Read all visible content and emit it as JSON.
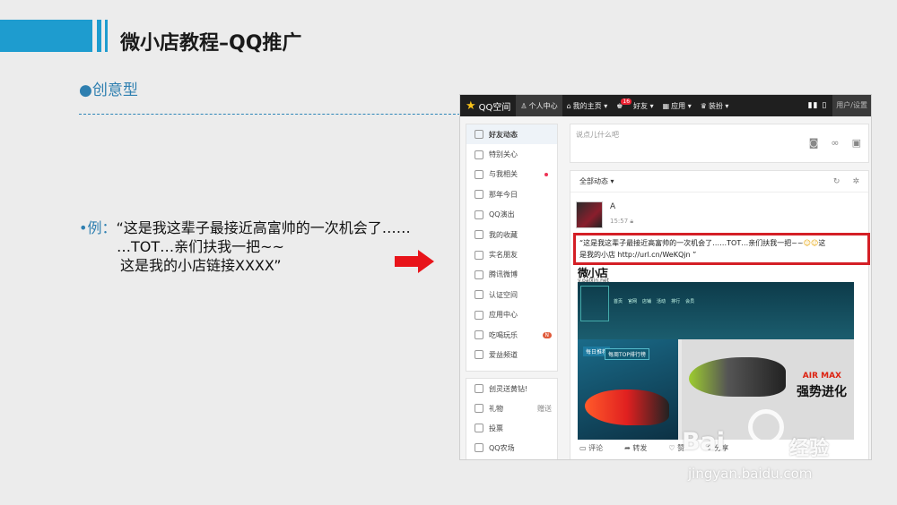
{
  "slide": {
    "title": "微小店教程–QQ推广",
    "subtitle": "●创意型",
    "example_label": "•例：",
    "example_line1": "“这是我这辈子最接近高富帅的一次机会了……",
    "example_line2": "…TOT…亲们扶我一把~~",
    "example_line3": "这是我的小店链接XXXX”"
  },
  "qzone": {
    "logo": "QQ空间",
    "nav": [
      {
        "label": "个人中心"
      },
      {
        "label": "我的主页 ▾"
      },
      {
        "label": "好友 ▾",
        "badge": "16"
      },
      {
        "label": "应用 ▾"
      },
      {
        "label": "装扮 ▾"
      }
    ],
    "user_panel": "用户/设置",
    "sidebar": [
      {
        "label": "好友动态"
      },
      {
        "label": "特别关心"
      },
      {
        "label": "与我相关"
      },
      {
        "label": "那年今日"
      },
      {
        "label": "QQ演出"
      },
      {
        "label": "我的收藏"
      },
      {
        "label": "实名朋友"
      },
      {
        "label": "腾讯微博"
      },
      {
        "label": "认证空间"
      },
      {
        "label": "应用中心"
      },
      {
        "label": "吃喝玩乐",
        "badge": "N"
      },
      {
        "label": "爱益频道"
      }
    ],
    "sidebar2": [
      {
        "label": "创灵送黄钻!"
      },
      {
        "label": "礼物",
        "extra": "赠送"
      },
      {
        "label": "投票"
      },
      {
        "label": "QQ农场"
      }
    ],
    "compose_placeholder": "说点儿什么吧",
    "feed_filter": "全部动态 ▾",
    "post": {
      "author": "A",
      "time": "15:57",
      "text_line1": "“这是我这辈子最接近高富帅的一次机会了……TOT…亲们扶我一把~~",
      "text_line2_prefix": "这",
      "text_line2": "是我的小店 http://url.cn/WeKQjn ”"
    },
    "shop": {
      "logo": "微小店",
      "url": "v.palxin.net",
      "menu": [
        "首页",
        "官网",
        "店铺",
        "活动",
        "排行",
        "会员"
      ],
      "day_badge": "每日推荐",
      "top_badge": "每周TOP排行榜",
      "brand": "AIR MAX",
      "slogan": "强势进化"
    },
    "actions": [
      "评论",
      "转发",
      "赞",
      "分享"
    ]
  },
  "watermark": {
    "logo": "Bai",
    "cn": "经验",
    "url": "jingyan.baidu.com"
  },
  "colors": {
    "accent_blue": "#1e9ccf",
    "highlight_red": "#d41f26",
    "arrow_red": "#e8141a"
  }
}
